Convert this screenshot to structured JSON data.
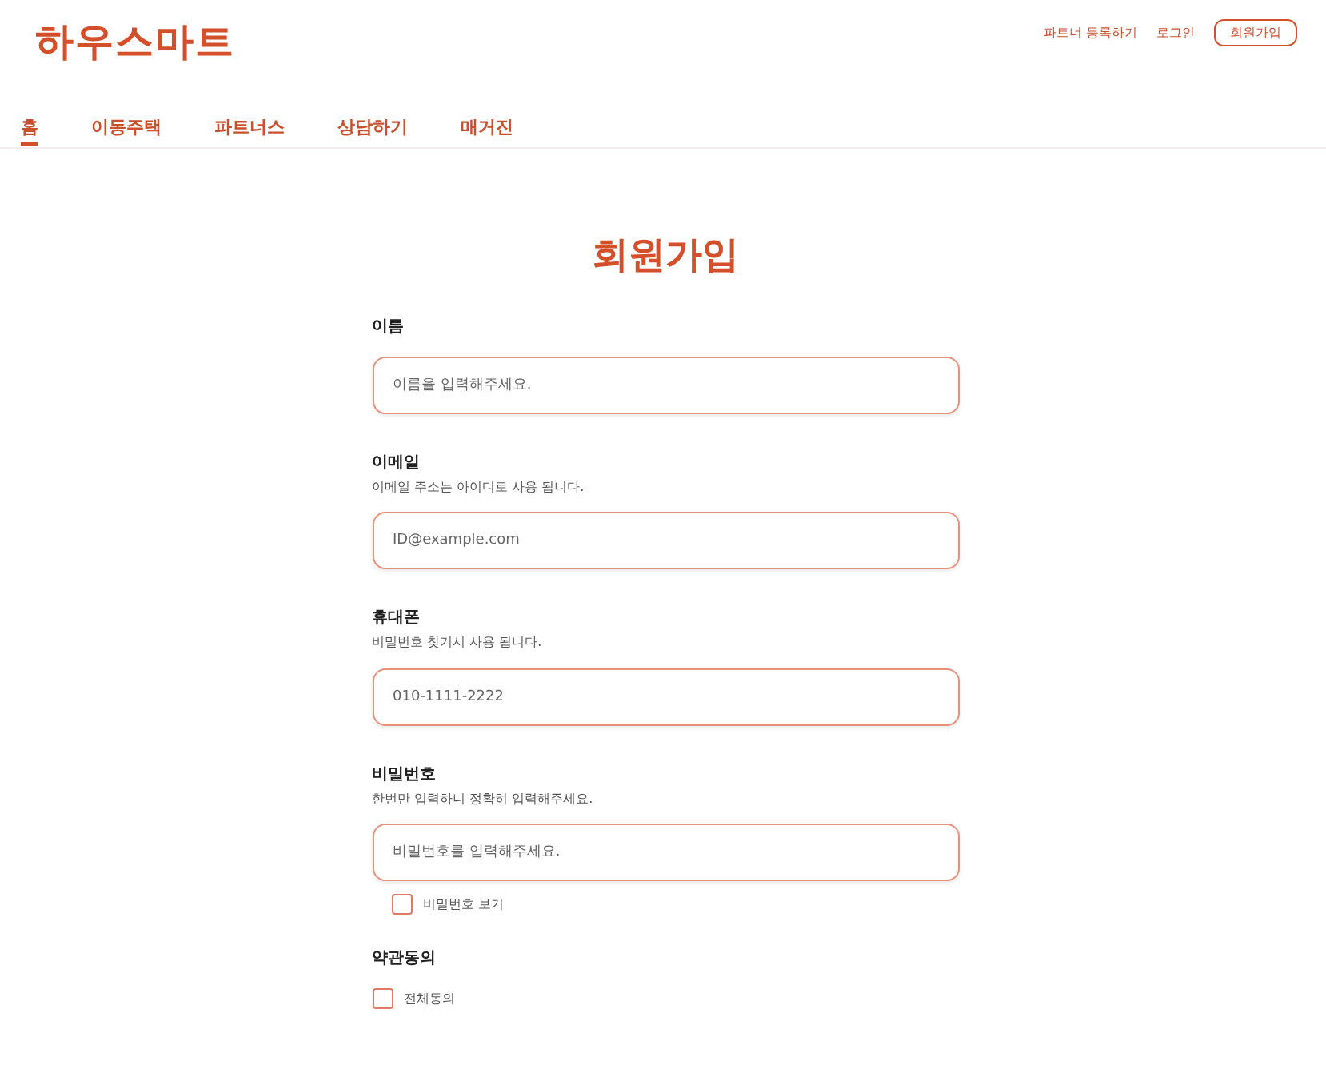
{
  "logo": "하우스마트",
  "header_links": [
    "파트너 등록하기",
    "로그인"
  ],
  "signup_button": "회원가입",
  "nav": [
    {
      "label": "홈",
      "selected": true
    },
    {
      "label": "이동주택",
      "selected": false
    },
    {
      "label": "파트너스",
      "selected": false
    },
    {
      "label": "상담하기",
      "selected": false
    },
    {
      "label": "매거진",
      "selected": false
    }
  ],
  "title": "회원가입",
  "fields": [
    {
      "label": "이름",
      "placeholder": "이름을 입력해주세요."
    },
    {
      "label": "이메일",
      "help": "이메일 주소는 아이디로 사용 됩니다.",
      "placeholder": "ID@example.com"
    },
    {
      "label": "휴대폰",
      "help": "비밀번호 찾기시 사용 됩니다.",
      "placeholder": "010-1111-2222"
    },
    {
      "label": "비밀번호",
      "help": "한번만 입력하니 정확히 입력해주세요.",
      "placeholder": "비밀번호를 입력해주세요.",
      "show_password": {
        "label": "비밀번호 보기",
        "checked": false
      }
    }
  ],
  "terms": {
    "label": "약관동의",
    "agree_all": {
      "label": "전체동의",
      "checked": false
    }
  }
}
